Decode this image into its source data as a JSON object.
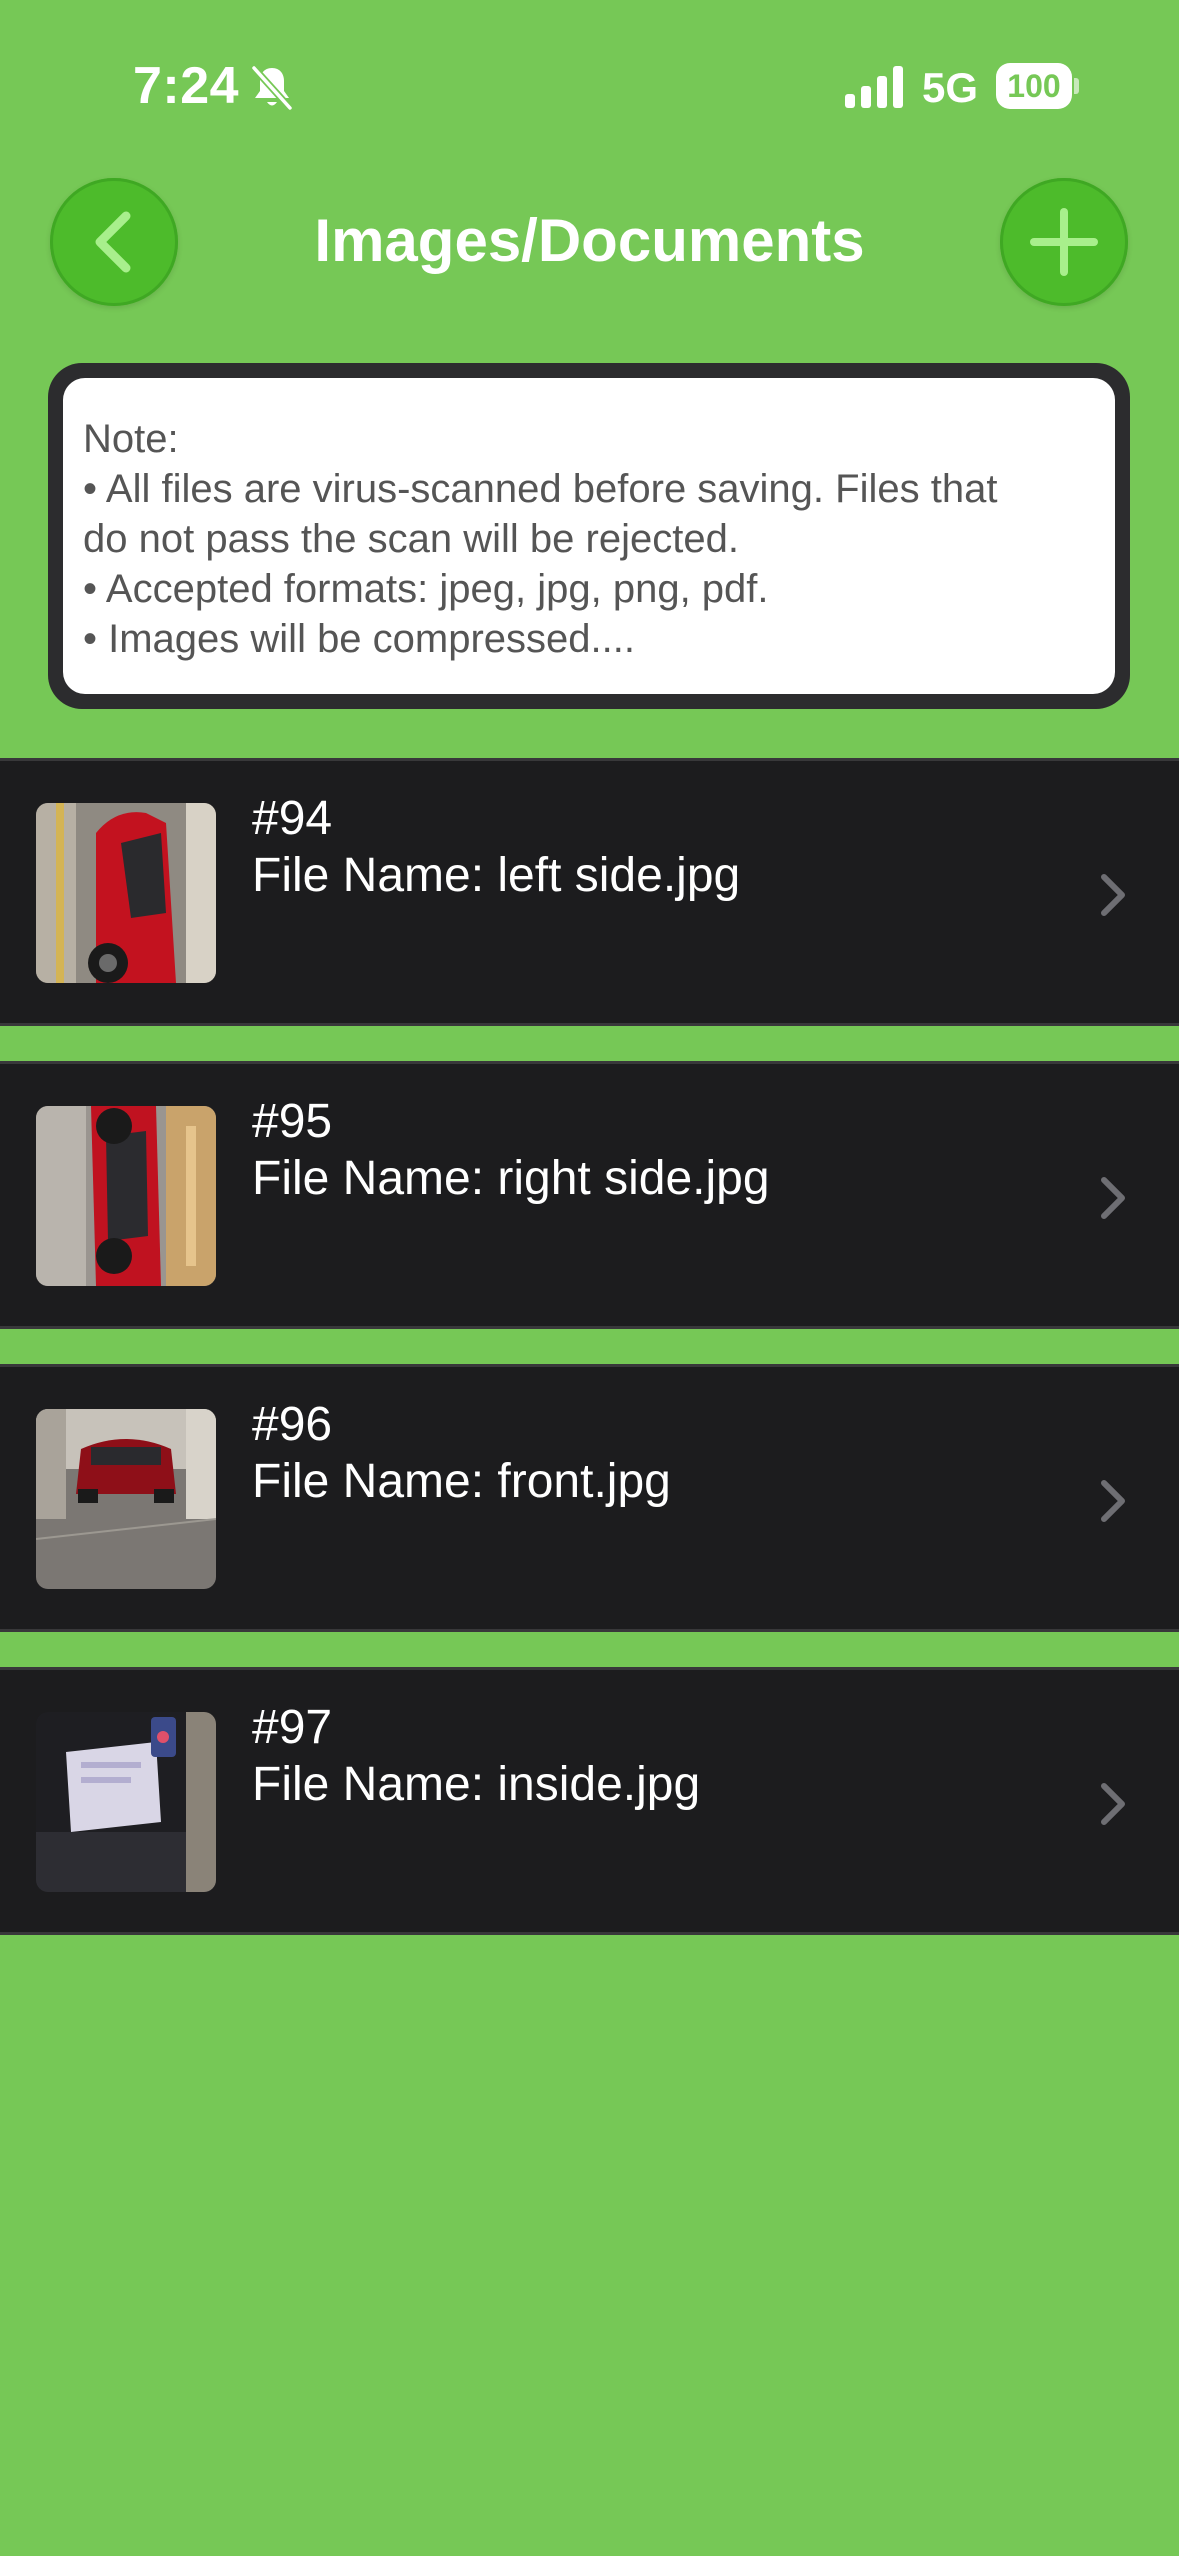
{
  "status_bar": {
    "time": "7:24",
    "network": "5G",
    "battery": "100",
    "icons": [
      "bell-slash-icon",
      "signal-icon",
      "battery-icon"
    ]
  },
  "header": {
    "title": "Images/Documents",
    "back_icon": "chevron-left-icon",
    "add_icon": "plus-icon"
  },
  "note": {
    "lines": [
      "Note:",
      "• All files are virus-scanned before saving. Files that",
      "do not pass the scan will be rejected.",
      "• Accepted formats: jpeg, jpg, png, pdf.",
      "• Images will be compressed...."
    ]
  },
  "files": [
    {
      "number": "#94",
      "name": "File Name: left side.jpg",
      "thumbnail": "red car left side photo"
    },
    {
      "number": "#95",
      "name": "File Name: right side.jpg",
      "thumbnail": "red car right side photo"
    },
    {
      "number": "#96",
      "name": "File Name: front.jpg",
      "thumbnail": "red car front photo"
    },
    {
      "number": "#97",
      "name": "File Name: inside.jpg",
      "thumbnail": "car interior photo"
    }
  ],
  "colors": {
    "background": "#76c856",
    "button": "#4dbb2b",
    "row_background": "#1c1c1e",
    "note_border": "#2c2c2e",
    "note_text": "#555555"
  }
}
